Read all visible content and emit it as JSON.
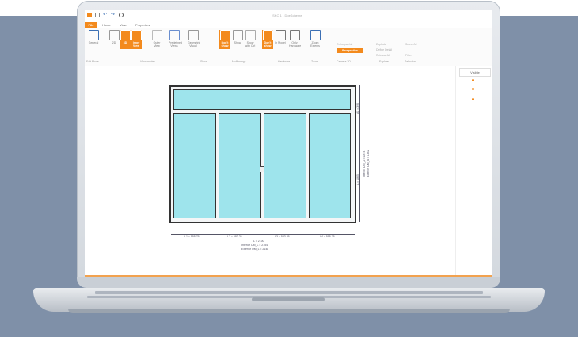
{
  "window": {
    "title": "ISKO 1 - DoeScheme"
  },
  "quick_access": [
    "app-icon",
    "save-icon",
    "undo-icon",
    "redo-icon",
    "search-icon"
  ],
  "menu": {
    "file": "File",
    "tabs": [
      "Home",
      "View",
      "Properties"
    ]
  },
  "ribbon": {
    "buttons": [
      {
        "id": "general",
        "label": "General",
        "on": false
      },
      {
        "id": "2d",
        "label": "2D",
        "on": false
      },
      {
        "id": "3d",
        "label": "3D",
        "on": true
      },
      {
        "id": "inner-view",
        "label": "Inner View",
        "on": true
      },
      {
        "id": "outer-view",
        "label": "Outer View",
        "on": false
      },
      {
        "id": "predefined-views",
        "label": "Predefined Views",
        "on": false
      },
      {
        "id": "geometric-visual",
        "label": "Geometric Visual",
        "on": false
      },
      {
        "id": "dont-show-mult",
        "label": "Don't show",
        "on": true
      },
      {
        "id": "show",
        "label": "Show",
        "on": false
      },
      {
        "id": "show-with-ctrl",
        "label": "Show with Ctrl",
        "on": false
      },
      {
        "id": "dont-show-hw",
        "label": "Don't show",
        "on": true
      },
      {
        "id": "in-model",
        "label": "In Model",
        "on": false
      },
      {
        "id": "only-hardware",
        "label": "Only Hardware",
        "on": false
      },
      {
        "id": "zoom-extents",
        "label": "Zoom Extents",
        "on": false
      }
    ],
    "camera": {
      "orthographic": "Orthographic",
      "perspective": "Perspective"
    },
    "explore": {
      "explode": "Explode",
      "define_detail": "Define Detail",
      "release_all": "Release All"
    },
    "selection": {
      "select_all": "Select All",
      "filter": "Filter"
    },
    "groups": [
      "Edit Mode",
      "View modes",
      "Show",
      "Mullionings",
      "Hardware",
      "Zoom",
      "Camera 3D",
      "Explore",
      "Selection"
    ]
  },
  "side_panel": {
    "tab": "Visible"
  },
  "drawing": {
    "bottom_dims": [
      "L1 = 555.75",
      "L2 = 583.25",
      "L3 = 583.25",
      "L4 = 555.75"
    ],
    "total": "L = 2100",
    "interior_om": "Interior OM_L = 2154",
    "exterior_om": "Exterior OM_L = 2148",
    "right_top": "A1 = 395",
    "right_side": "A = 1805",
    "interior_om_h": "Interior OM_A = 1874",
    "exterior_om_h": "Exterior OM_A = 1842"
  }
}
